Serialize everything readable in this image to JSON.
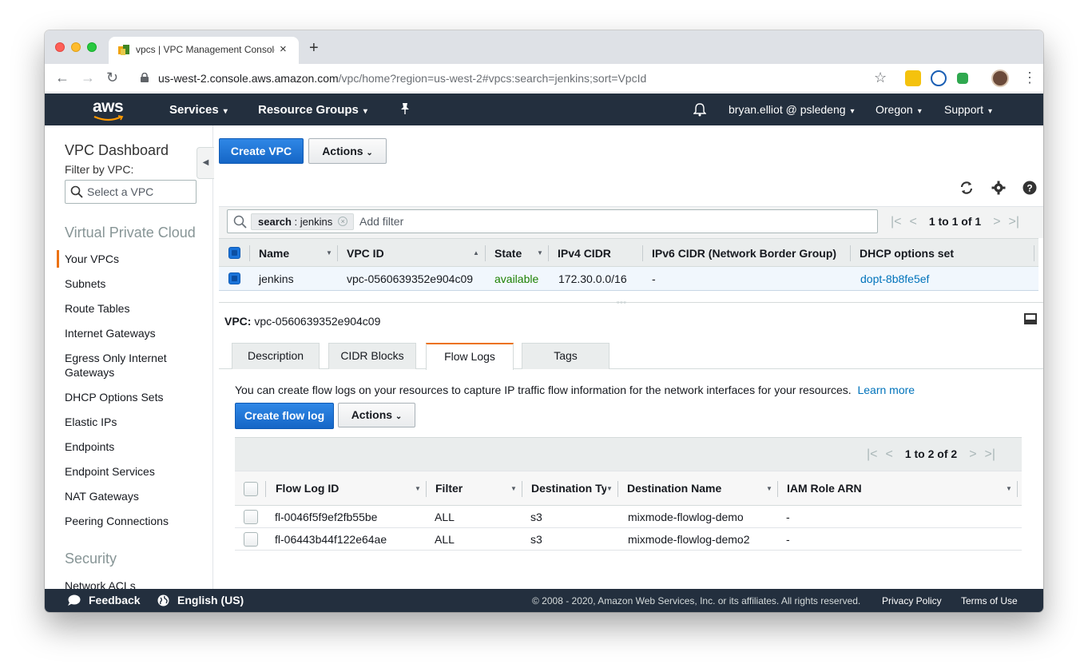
{
  "browser": {
    "tab_title": "vpcs | VPC Management Console",
    "tab_close": "×",
    "new_tab": "+",
    "url_host": "us-west-2.console.aws.amazon.com",
    "url_path": "/vpc/home?region=us-west-2#vpcs:search=jenkins;sort=VpcId",
    "icons": [
      "back-icon",
      "forward-icon",
      "reload-icon",
      "lock-icon",
      "star-icon",
      "menu-kebab-icon"
    ]
  },
  "aws_nav": {
    "logo": "aws",
    "services": "Services",
    "resource_groups": "Resource Groups",
    "account": "bryan.elliot @ psledeng",
    "region": "Oregon",
    "support": "Support",
    "caret": "▾"
  },
  "sidebar": {
    "title": "VPC Dashboard",
    "filter_label": "Filter by VPC:",
    "select_placeholder": "Select a VPC",
    "section_vpc": "Virtual Private Cloud",
    "items": [
      "Your VPCs",
      "Subnets",
      "Route Tables",
      "Internet Gateways",
      "Egress Only Internet Gateways",
      "DHCP Options Sets",
      "Elastic IPs",
      "Endpoints",
      "Endpoint Services",
      "NAT Gateways",
      "Peering Connections"
    ],
    "section_security": "Security",
    "partial_item": "Network ACLs"
  },
  "toolbar": {
    "create_vpc": "Create VPC",
    "actions": "Actions"
  },
  "filter": {
    "token_key": "search",
    "token_value": "jenkins",
    "add_filter": "Add filter",
    "pager": "1 to 1 of 1"
  },
  "vpc_table": {
    "headers": [
      "Name",
      "VPC ID",
      "State",
      "IPv4 CIDR",
      "IPv6 CIDR (Network Border Group)",
      "DHCP options set"
    ],
    "row": {
      "name": "jenkins",
      "vpc_id": "vpc-0560639352e904c09",
      "state": "available",
      "ipv4": "172.30.0.0/16",
      "ipv6": "-",
      "dhcp": "dopt-8b8fe5ef"
    }
  },
  "detail": {
    "vpc_label": "VPC:",
    "vpc_id": "vpc-0560639352e904c09",
    "tabs": [
      "Description",
      "CIDR Blocks",
      "Flow Logs",
      "Tags"
    ],
    "active_tab": "Flow Logs",
    "info_text": "You can create flow logs on your resources to capture IP traffic flow information for the network interfaces for your resources.",
    "learn_more": "Learn more",
    "create_flow_log": "Create flow log",
    "actions": "Actions",
    "pager": "1 to 2 of 2"
  },
  "flow_logs": {
    "headers": [
      "Flow Log ID",
      "Filter",
      "Destination Type",
      "Destination Name",
      "IAM Role ARN"
    ],
    "rows": [
      {
        "id": "fl-0046f5f9ef2fb55be",
        "filter": "ALL",
        "dest_type": "s3",
        "dest_name": "mixmode-flowlog-demo",
        "iam": "-"
      },
      {
        "id": "fl-06443b44f122e64ae",
        "filter": "ALL",
        "dest_type": "s3",
        "dest_name": "mixmode-flowlog-demo2",
        "iam": "-"
      }
    ]
  },
  "footer": {
    "feedback": "Feedback",
    "language": "English (US)",
    "copyright": "© 2008 - 2020, Amazon Web Services, Inc. or its affiliates. All rights reserved.",
    "privacy": "Privacy Policy",
    "terms": "Terms of Use"
  },
  "colors": {
    "aws_nav": "#232f3e",
    "primary_button": "#1a73d9",
    "active_tab_accent": "#ec7211",
    "link": "#0073bb",
    "available": "#1d8102"
  }
}
